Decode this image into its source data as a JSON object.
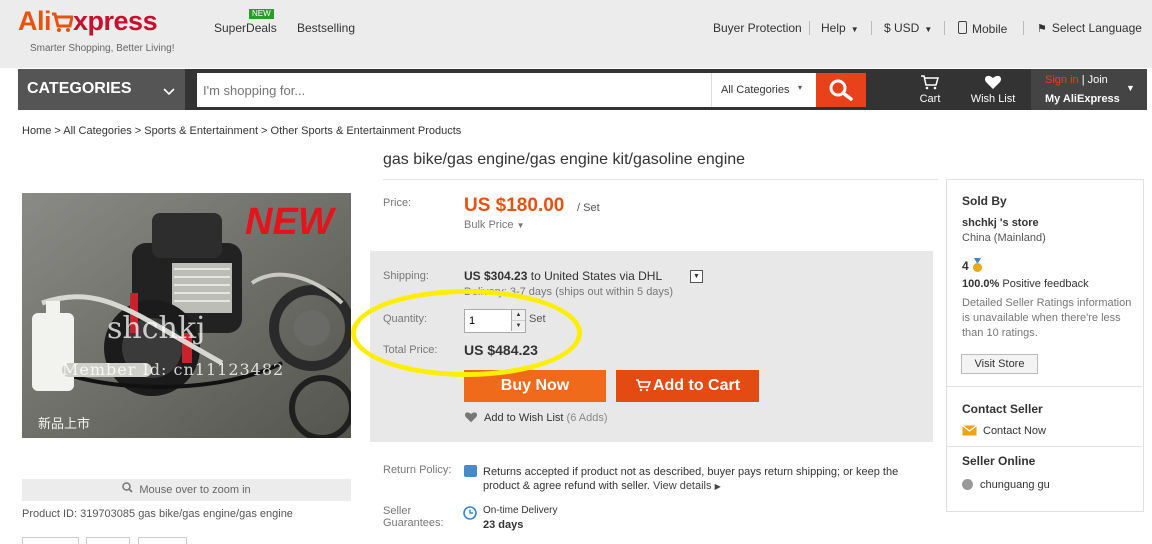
{
  "header": {
    "logo_ali": "Ali",
    "logo_xpress": "xpress",
    "tagline": "Smarter Shopping, Better Living!",
    "nav_left": [
      {
        "label": "SuperDeals",
        "badge": "NEW"
      },
      {
        "label": "Bestselling"
      }
    ],
    "buyer_protection": "Buyer Protection",
    "help": "Help",
    "currency": "$ USD",
    "mobile": "Mobile",
    "language": "Select Language"
  },
  "navbar": {
    "categories_label": "CATEGORIES",
    "search_placeholder": "I'm shopping for...",
    "search_category": "All Categories",
    "cart_label": "Cart",
    "wishlist_label": "Wish List",
    "signin_label": "Sign in",
    "join_label": "| Join",
    "my_account_label": "My AliExpress"
  },
  "breadcrumb": "Home > All Categories > Sports & Entertainment > Other Sports & Entertainment Products",
  "gallery": {
    "zoom_hint": "Mouse over to zoom in",
    "image_overlay_new": "NEW",
    "watermark_store": "shchkj",
    "watermark_member": "Member Id: cn11123482",
    "image_chinese_caption": "新品上市"
  },
  "product": {
    "id_line": "Product ID: 319703085 gas bike/gas engine/gas engine",
    "title": "gas bike/gas engine/gas engine kit/gasoline engine",
    "price_label": "Price:",
    "price": "US $180.00",
    "price_unit": "/ Set",
    "bulk_price": "Bulk Price",
    "shipping_label": "Shipping:",
    "shipping_cost": "US $304.23",
    "shipping_to": "to United States via DHL",
    "delivery": "Delivery: 3-7 days (ships out within 5 days)",
    "quantity_label": "Quantity:",
    "quantity_value": "1",
    "quantity_unit": "Set",
    "total_label": "Total Price:",
    "total_price": "US $484.23",
    "buy_now": "Buy Now",
    "add_to_cart": "Add to Cart",
    "wishlist": "Add to Wish List",
    "wishlist_count": "(6 Adds)",
    "return_label": "Return Policy:",
    "return_text_1": "Returns accepted if product not as described, buyer pays return shipping; or keep the",
    "return_text_2": "product & agree refund with seller.",
    "view_details": "View details",
    "guarantee_label_1": "Seller",
    "guarantee_label_2": "Guarantees:",
    "guarantee_title": "On-time Delivery",
    "guarantee_days": "23 days"
  },
  "seller": {
    "sold_by": "Sold By",
    "store_name": "shchkj 's store",
    "country": "China (Mainland)",
    "level": "4",
    "feedback_pct": "100.0%",
    "feedback_text": "Positive feedback",
    "ratings_note": "Detailed Seller Ratings information is unavailable when there're less than 10 ratings.",
    "visit_store": "Visit Store",
    "contact_heading": "Contact Seller",
    "contact_now": "Contact Now",
    "online_heading": "Seller Online",
    "online_user": "chunguang gu"
  },
  "colors": {
    "brand_orange": "#e8520f",
    "brand_red": "#c8102e",
    "buy_button": "#f06a1c",
    "cart_button": "#e34b12",
    "annotation_ellipse": "#ffee00"
  }
}
